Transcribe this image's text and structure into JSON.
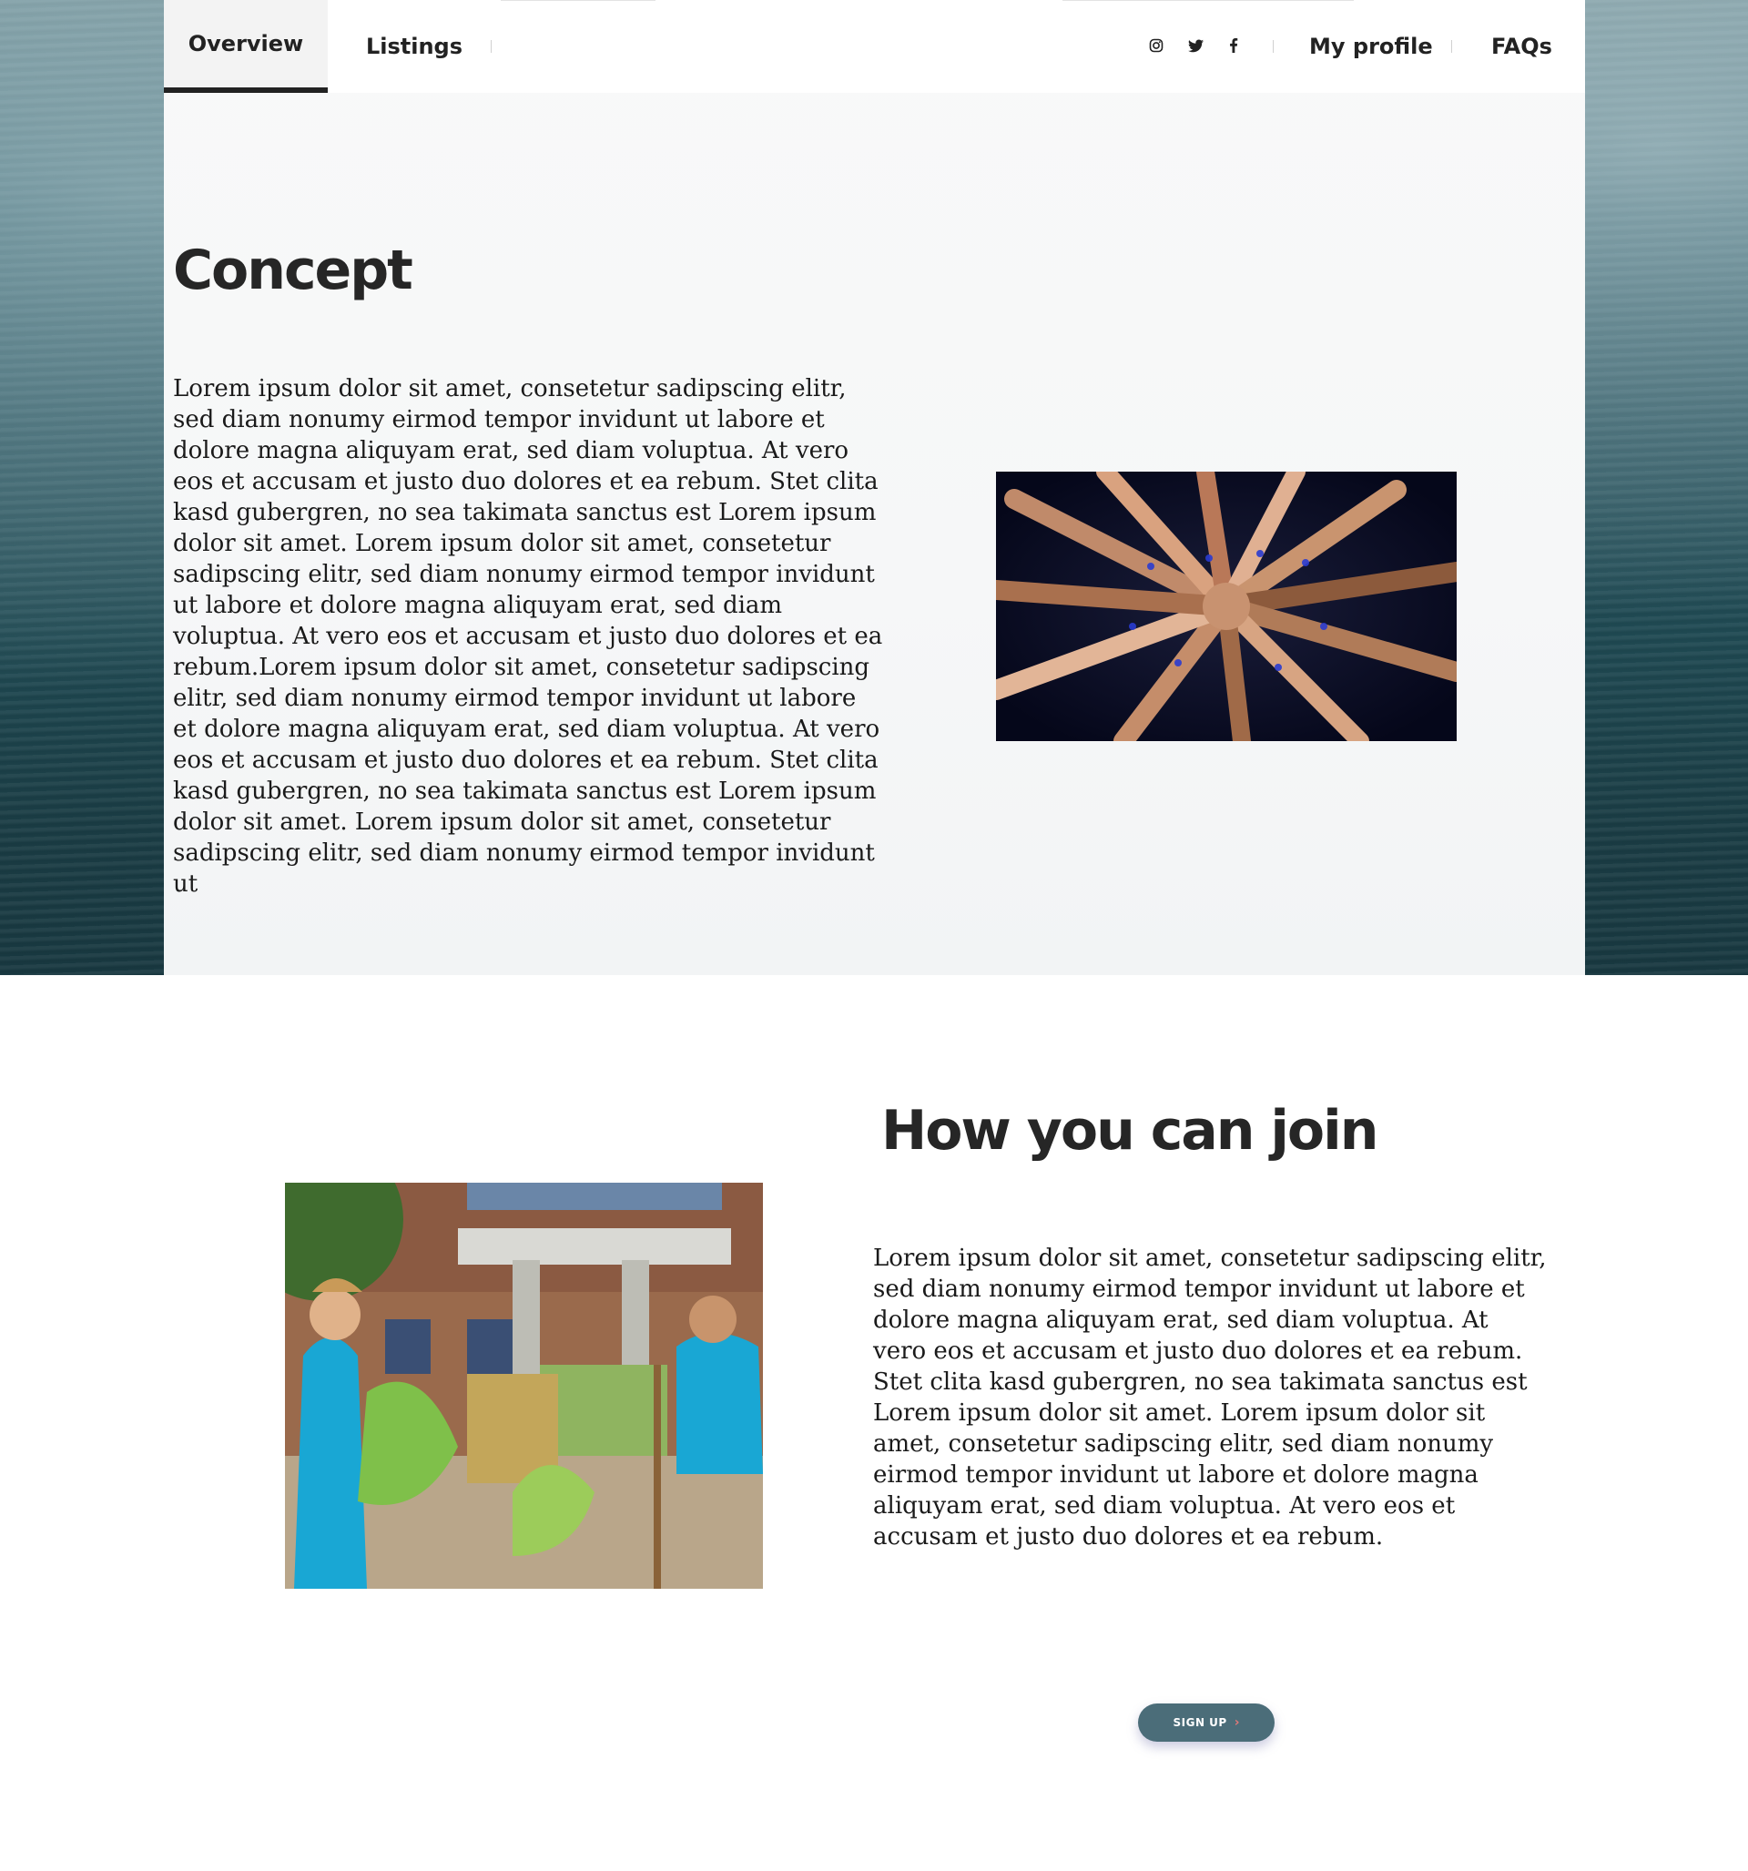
{
  "nav": {
    "tabs": [
      {
        "label": "Overview",
        "active": true
      },
      {
        "label": "Listings",
        "active": false
      }
    ],
    "social_icons": [
      "instagram-icon",
      "twitter-icon",
      "facebook-icon"
    ],
    "links": {
      "profile": "My profile",
      "faqs": "FAQs"
    }
  },
  "concept": {
    "title": "Concept",
    "body": "Lorem ipsum dolor sit amet, consetetur sadipscing elitr, sed diam nonumy eirmod tempor invidunt ut labore et dolore magna aliquyam erat, sed diam voluptua. At vero eos et accusam et justo duo dolores et ea rebum. Stet clita kasd gubergren, no sea takimata sanctus est Lorem ipsum dolor sit amet. Lorem ipsum dolor sit amet, consetetur sadipscing elitr, sed diam nonumy eirmod tempor invidunt ut labore et dolore magna aliquyam erat, sed diam voluptua. At vero eos et accusam et justo duo dolores et ea rebum.Lorem ipsum dolor sit amet, consetetur sadipscing elitr, sed diam nonumy eirmod tempor invidunt ut labore et dolore magna aliquyam erat, sed diam voluptua. At vero eos et accusam et justo duo dolores et ea rebum. Stet clita kasd gubergren, no sea takimata sanctus est Lorem ipsum dolor sit amet. Lorem ipsum dolor sit amet, consetetur sadipscing elitr, sed diam nonumy eirmod tempor invidunt ut"
  },
  "join": {
    "title": "How you can join",
    "body": "Lorem ipsum dolor sit amet, consetetur sadipscing elitr, sed diam nonumy eirmod tempor invidunt ut labore et dolore magna aliquyam erat, sed diam voluptua. At vero eos et accusam et justo duo dolores et ea rebum. Stet clita kasd gubergren, no sea takimata sanctus est Lorem ipsum dolor sit amet. Lorem ipsum dolor sit amet, consetetur sadipscing elitr, sed diam nonumy eirmod tempor invidunt ut labore et dolore magna aliquyam erat, sed diam voluptua. At vero eos et accusam et justo duo dolores et ea rebum.",
    "button_label": "SIGN UP"
  },
  "colors": {
    "button": "#4b6d79",
    "chevron": "#e07878",
    "text": "#1a1a1a"
  }
}
